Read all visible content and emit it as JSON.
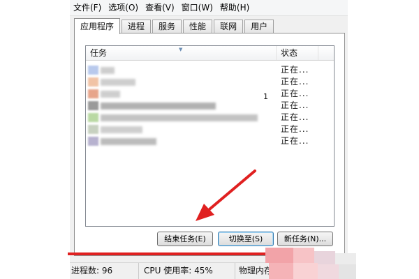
{
  "menu": [
    "文件(F)",
    "选项(O)",
    "查看(V)",
    "窗口(W)",
    "帮助(H)"
  ],
  "tabs": [
    {
      "label": "应用程序",
      "active": true
    },
    {
      "label": "进程",
      "active": false
    },
    {
      "label": "服务",
      "active": false
    },
    {
      "label": "性能",
      "active": false
    },
    {
      "label": "联网",
      "active": false
    },
    {
      "label": "用户",
      "active": false
    }
  ],
  "list": {
    "headers": {
      "task": "任务",
      "status": "状态"
    },
    "rows": [
      {
        "status": "正在..."
      },
      {
        "status": "正在..."
      },
      {
        "status": "正在..."
      },
      {
        "status": "正在..."
      },
      {
        "status": "正在..."
      },
      {
        "status": "正在..."
      },
      {
        "status": "正在..."
      }
    ],
    "stray_mark": "1"
  },
  "buttons": {
    "end_task": "结束任务(E)",
    "switch_to": "切换至(S)",
    "new_task": "新任务(N)..."
  },
  "statusbar": {
    "processes": "进程数: 96",
    "cpu": "CPU 使用率: 45%",
    "memory": "物理内存"
  },
  "colors": {
    "annotation": "#e02020"
  }
}
